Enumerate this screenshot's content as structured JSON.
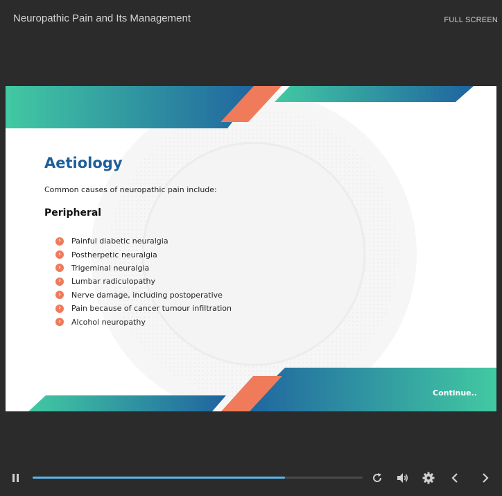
{
  "header": {
    "course_title": "Neuropathic Pain and Its Management",
    "fullscreen_label": "FULL SCREEN"
  },
  "slide": {
    "heading": "Aetiology",
    "intro": "Common causes of neuropathic pain include:",
    "subheading": "Peripheral",
    "bullets": [
      "Painful diabetic neuralgia",
      "Postherpetic neuralgia",
      "Trigeminal neuralgia",
      "Lumbar radiculopathy",
      "Nerve damage, including postoperative",
      "Pain because of cancer tumour infiltration",
      "Alcohol neuropathy"
    ],
    "continue_label": "Continue..",
    "colors": {
      "heading_blue": "#1f5f9a",
      "teal": "#3ec9a0",
      "blue": "#1f63a0",
      "orange": "#ef7b5b"
    }
  },
  "player": {
    "progress_fraction": 0.765,
    "accent": "#5bb6f0",
    "icons": [
      "pause-icon",
      "replay-icon",
      "volume-icon",
      "settings-icon",
      "previous-icon",
      "next-icon"
    ]
  }
}
